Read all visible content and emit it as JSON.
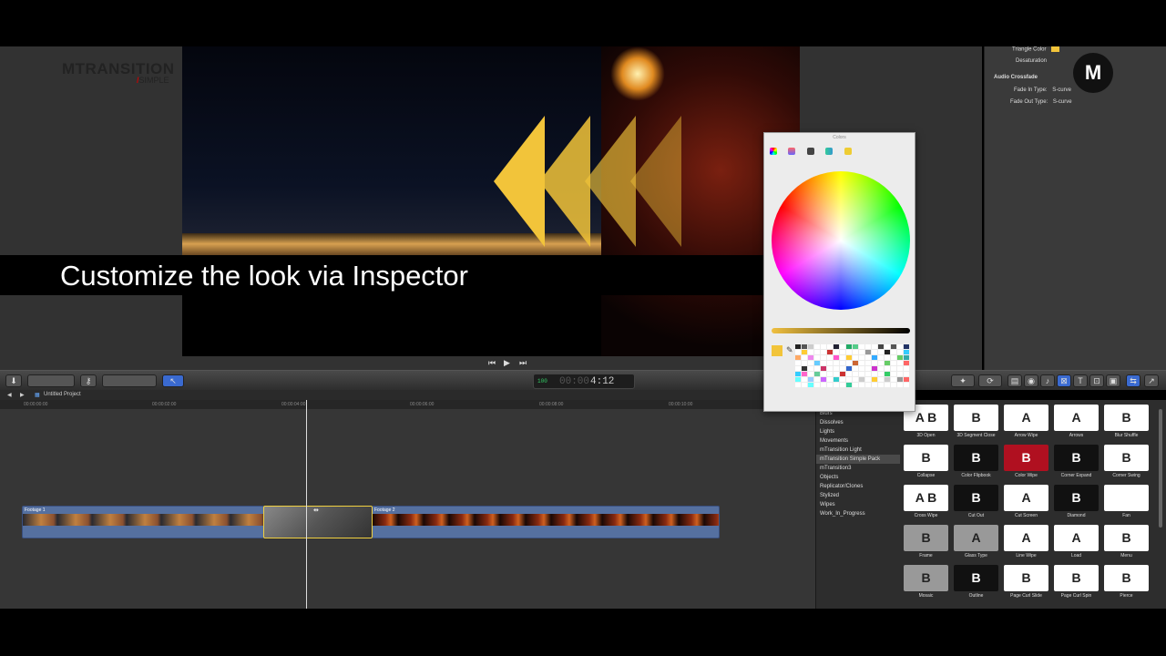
{
  "caption": "Customize the look via Inspector",
  "logo": {
    "main": "MTRANSITION",
    "sub": "SIMPLE",
    "slash": "/"
  },
  "corner_logo": "M",
  "inspector": {
    "rows": [
      {
        "label": "Triangle Color",
        "value": ""
      },
      {
        "label": "Desaturation",
        "value": ""
      },
      {
        "label": "Audio Crossfade",
        "value": ""
      },
      {
        "label": "Fade In Type:",
        "value": "S-curve"
      },
      {
        "label": "Fade Out Type:",
        "value": "S-curve"
      }
    ]
  },
  "colors_panel": {
    "title": "Colors",
    "current_color": "#f2c43a",
    "palette": [
      "#222",
      "#555",
      "#ccc",
      "#fff",
      "#fff",
      "#fff",
      "#223",
      "#fff",
      "#2a6",
      "#5c8",
      "#fff",
      "#fff",
      "#fff",
      "#444",
      "#fff",
      "#555",
      "#fff",
      "#236",
      "#fff",
      "#fc3",
      "#fff",
      "#fff",
      "#fff",
      "#c33",
      "#fff",
      "#fff",
      "#fff",
      "#fff",
      "#fff",
      "#999",
      "#fff",
      "#fff",
      "#222",
      "#fff",
      "#fff",
      "#3cf",
      "#fa6",
      "#fff",
      "#e8e",
      "#fff",
      "#fff",
      "#fff",
      "#f5c",
      "#fff",
      "#fc3",
      "#fff",
      "#fff",
      "#fff",
      "#3af",
      "#fff",
      "#fff",
      "#fff",
      "#6c6",
      "#3aa",
      "#fff",
      "#fff",
      "#fff",
      "#6cf",
      "#fff",
      "#fff",
      "#fff",
      "#fff",
      "#fff",
      "#c63",
      "#fff",
      "#fff",
      "#fff",
      "#fff",
      "#6c6",
      "#fff",
      "#fff",
      "#f66",
      "#fff",
      "#333",
      "#fff",
      "#fff",
      "#c36",
      "#fff",
      "#fff",
      "#fff",
      "#36c",
      "#fff",
      "#fff",
      "#fff",
      "#c3c",
      "#fff",
      "#fff",
      "#fff",
      "#fff",
      "#fff",
      "#3cf",
      "#f6c",
      "#fff",
      "#6c9",
      "#fff",
      "#fff",
      "#fff",
      "#c33",
      "#fff",
      "#fff",
      "#fff",
      "#fff",
      "#fff",
      "#fff",
      "#3c6",
      "#fff",
      "#fff",
      "#fff",
      "#6ff",
      "#fff",
      "#9cf",
      "#fff",
      "#c6f",
      "#fff",
      "#3cc",
      "#fff",
      "#fff",
      "#fff",
      "#ccc",
      "#fff",
      "#fc3",
      "#fff",
      "#ccc",
      "#fff",
      "#999",
      "#f66",
      "#fff",
      "#fff",
      "#6ff",
      "#fff",
      "#fff",
      "#fff",
      "#fff",
      "#fff",
      "#3c9",
      "#fff",
      "#fff",
      "#fff",
      "#fff",
      "#fff",
      "#fff",
      "#fff",
      "#fff",
      "#fff"
    ]
  },
  "toolbar": {
    "timecode": "4:12",
    "timecode_dim": "00:00",
    "timecode_icon": "100"
  },
  "timeline": {
    "project_name": "Untitled Project",
    "ruler": [
      "00:00:00:00",
      "00:00:02:00",
      "00:00:04:00",
      "00:00:06:00",
      "00:00:08:00",
      "00:00:10:00"
    ],
    "clips": [
      {
        "label": "Footage 1"
      },
      {
        "label": "Footage 2"
      }
    ],
    "transition_icon": "⇹"
  },
  "browser": {
    "categories": [
      "Blurs",
      "Dissolves",
      "Lights",
      "Movements",
      "mTransition Light",
      "mTransition Simple Pack",
      "mTransition3",
      "Objects",
      "Replicator/Clones",
      "Stylized",
      "Wipes",
      "Work_In_Progress"
    ],
    "selected_category": "mTransition Simple Pack",
    "tiles": [
      {
        "label": "3D Open",
        "glyph": "A B",
        "style": "light"
      },
      {
        "label": "3D Segment Close",
        "glyph": "B",
        "style": "light"
      },
      {
        "label": "Arrow Wipe",
        "glyph": "A",
        "style": "light"
      },
      {
        "label": "Arrows",
        "glyph": "A",
        "style": "light"
      },
      {
        "label": "Blur Shuffle",
        "glyph": "B",
        "style": "light"
      },
      {
        "label": "Collapse",
        "glyph": "B",
        "style": "light"
      },
      {
        "label": "Color Flipbook",
        "glyph": "B",
        "style": "dark"
      },
      {
        "label": "Color Wipe",
        "glyph": "B",
        "style": "red"
      },
      {
        "label": "Corner Expand",
        "glyph": "B",
        "style": "dark"
      },
      {
        "label": "Corner Swing",
        "glyph": "B",
        "style": "light"
      },
      {
        "label": "Cross Wipe",
        "glyph": "A B",
        "style": "light"
      },
      {
        "label": "Cut Out",
        "glyph": "B",
        "style": "dark"
      },
      {
        "label": "Cut Screen",
        "glyph": "A",
        "style": "light"
      },
      {
        "label": "Diamond",
        "glyph": "B",
        "style": "dark"
      },
      {
        "label": "Fan",
        "glyph": "",
        "style": "light"
      },
      {
        "label": "Frame",
        "glyph": "B",
        "style": "gray"
      },
      {
        "label": "Glass Type",
        "glyph": "A",
        "style": "gray"
      },
      {
        "label": "Line Wipe",
        "glyph": "A",
        "style": "light"
      },
      {
        "label": "Load",
        "glyph": "A",
        "style": "light"
      },
      {
        "label": "Menu",
        "glyph": "B",
        "style": "light"
      },
      {
        "label": "Mosaic",
        "glyph": "B",
        "style": "gray"
      },
      {
        "label": "Outline",
        "glyph": "B",
        "style": "dark"
      },
      {
        "label": "Page Curl Slide",
        "glyph": "B",
        "style": "light"
      },
      {
        "label": "Page Curl Spin",
        "glyph": "B",
        "style": "light"
      },
      {
        "label": "Pierce",
        "glyph": "B",
        "style": "light"
      }
    ]
  }
}
